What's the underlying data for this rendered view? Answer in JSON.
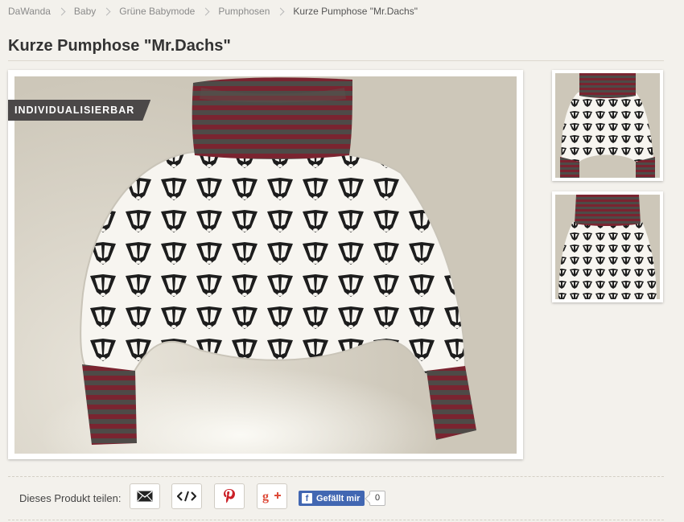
{
  "breadcrumb": {
    "items": [
      {
        "label": "DaWanda"
      },
      {
        "label": "Baby"
      },
      {
        "label": "Grüne Babymode"
      },
      {
        "label": "Pumphosen"
      },
      {
        "label": "Kurze Pumphose \"Mr.Dachs\""
      }
    ]
  },
  "product": {
    "title": "Kurze Pumphose \"Mr.Dachs\"",
    "badge": "INDIVIDUALISIERBAR"
  },
  "share": {
    "label": "Dieses Produkt teilen:",
    "buttons": [
      {
        "icon": "envelope-icon"
      },
      {
        "icon": "embed-code-icon"
      },
      {
        "icon": "pinterest-icon",
        "color": "#cb2027"
      },
      {
        "icon": "google-plus-icon",
        "color": "#dd4b39"
      }
    ],
    "facebook": {
      "label": "Gefällt mir",
      "count": "0",
      "color": "#4267b2"
    }
  },
  "colors": {
    "background": "#f3f1ec",
    "band_red": "#7a2430",
    "band_grey": "#4e4a47",
    "fabric": "#f7f5f0"
  }
}
